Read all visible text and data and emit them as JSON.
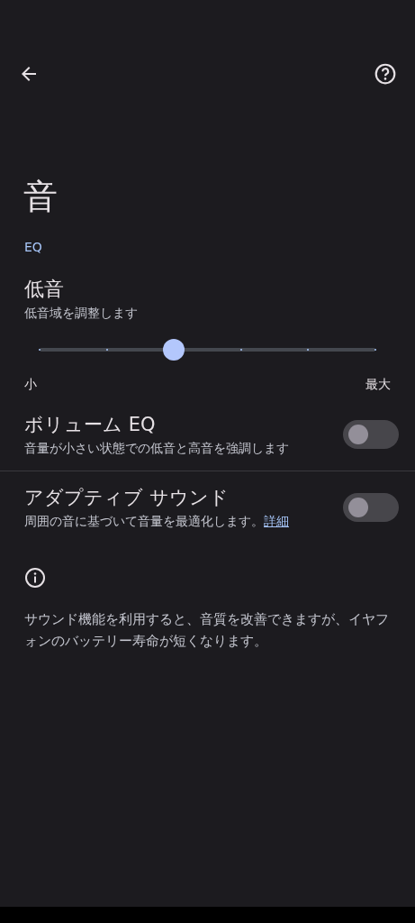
{
  "header": {
    "title": "音"
  },
  "section": {
    "label": "EQ"
  },
  "bass": {
    "title": "低音",
    "subtitle": "低音域を調整します",
    "level": 0.4,
    "min_label": "小",
    "max_label": "最大"
  },
  "toggles": [
    {
      "title": "ボリューム EQ",
      "description": "音量が小さい状態での低音と高音を強調します",
      "on": false
    },
    {
      "title": "アダプティブ サウンド",
      "description": "周囲の音に基づいて音量を最適化します。",
      "link": "詳細",
      "on": false
    }
  ],
  "info": "サウンド機能を利用すると、音質を改善できますが、イヤフォンのバッテリー寿命が短くなります。"
}
